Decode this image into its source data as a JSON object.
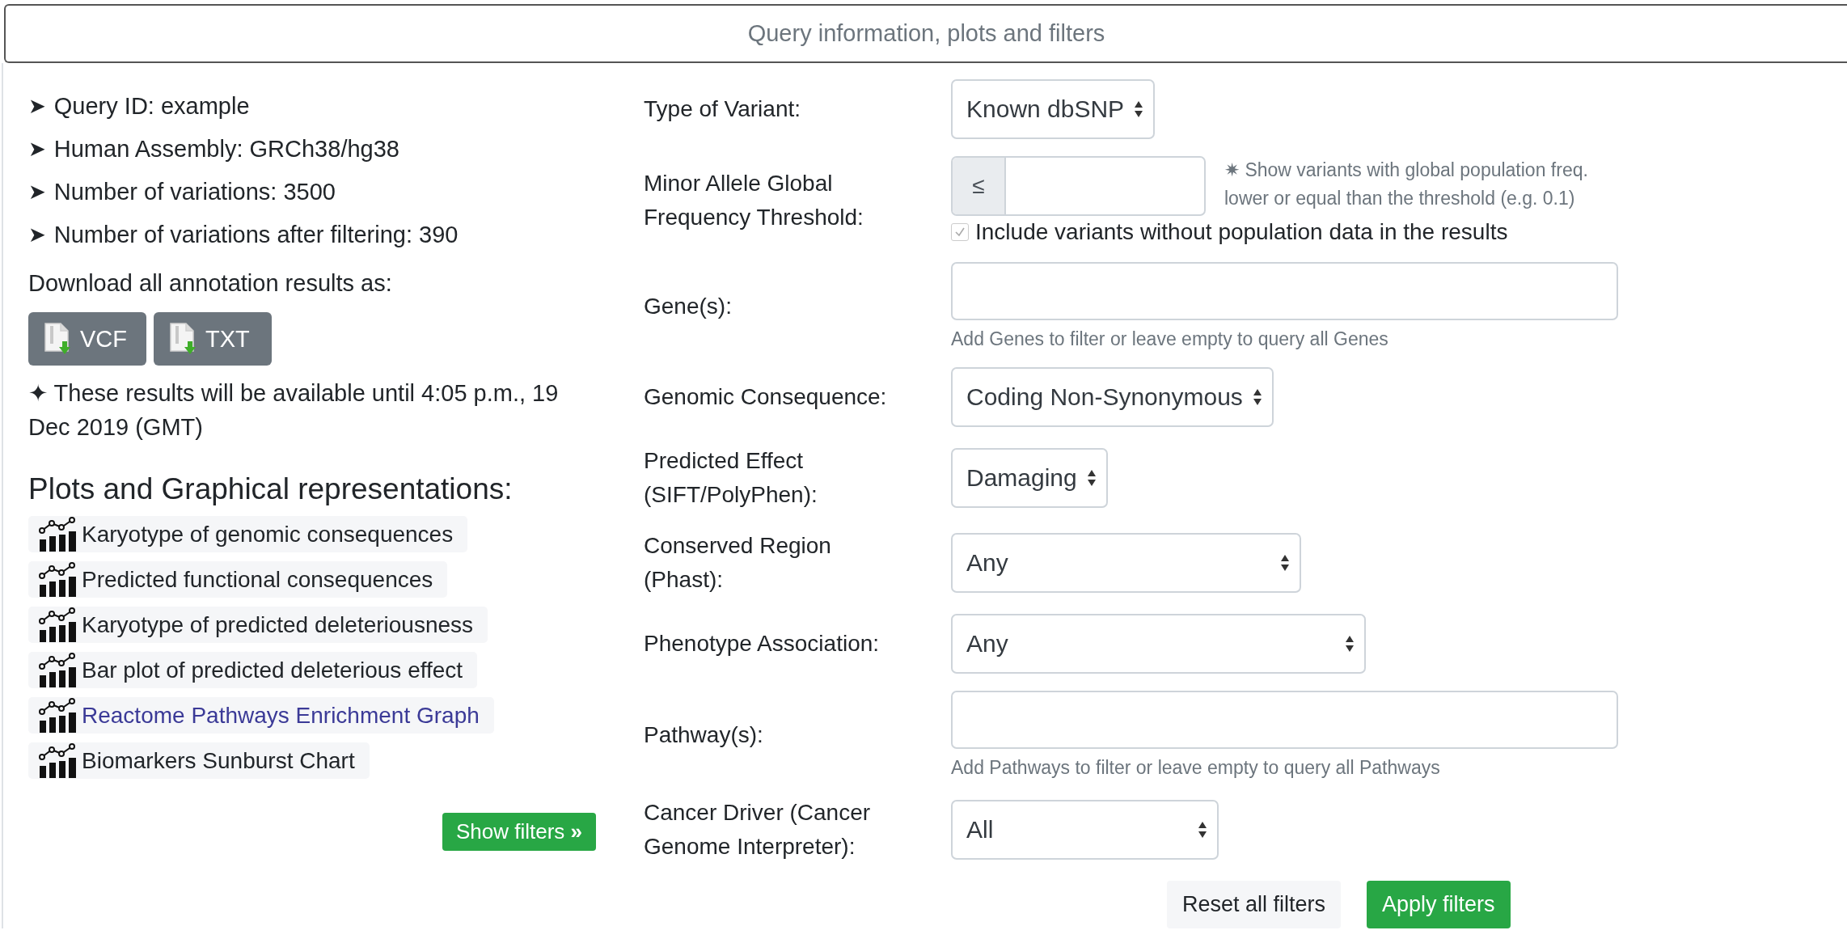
{
  "header": {
    "title": "Query information, plots and filters"
  },
  "query_info": [
    {
      "marker": "➤",
      "text": "Query ID: example"
    },
    {
      "marker": "➤",
      "text": "Human Assembly: GRCh38/hg38"
    },
    {
      "marker": "➤",
      "text": "Number of variations: 3500"
    },
    {
      "marker": "➤",
      "text": "Number of variations after filtering: 390"
    }
  ],
  "download": {
    "label": "Download all annotation results as:",
    "buttons": [
      {
        "label": "VCF"
      },
      {
        "label": "TXT"
      }
    ]
  },
  "availability": {
    "marker": "✦",
    "text": "These results will be available until 4:05 p.m., 19 Dec 2019 (GMT)"
  },
  "plots": {
    "title": "Plots and Graphical representations:",
    "items": [
      {
        "label": "Karyotype of genomic consequences",
        "visited": false
      },
      {
        "label": "Predicted functional consequences",
        "visited": false
      },
      {
        "label": "Karyotype of predicted deleteriousness",
        "visited": false
      },
      {
        "label": "Bar plot of predicted deleterious effect",
        "visited": false
      },
      {
        "label": "Reactome Pathways Enrichment Graph",
        "visited": true
      },
      {
        "label": "Biomarkers Sunburst Chart",
        "visited": false
      }
    ]
  },
  "show_filters": {
    "label": "Show filters",
    "marker": "»"
  },
  "filters": [
    {
      "kind": "select",
      "label": "Type of Variant:",
      "value": "Known dbSNP"
    },
    {
      "kind": "threshold",
      "label": "Minor Allele Global Frequency Threshold:",
      "prefix": "≤",
      "note_marker": "✷",
      "note": "Show variants with global population freq. lower or equal than the threshold (e.g. 0.1)",
      "checkbox": {
        "label": "Include variants without population data in the results",
        "checked": true,
        "disabled": true
      }
    },
    {
      "kind": "text",
      "label": "Gene(s):",
      "help": "Add Genes to filter or leave empty to query all Genes"
    },
    {
      "kind": "select",
      "label": "Genomic Consequence:",
      "value": "Coding Non-Synonymous"
    },
    {
      "kind": "select",
      "label": "Predicted Effect (SIFT/PolyPhen):",
      "value": "Damaging"
    },
    {
      "kind": "select",
      "label": "Conserved Region (Phast):",
      "value": "Any"
    },
    {
      "kind": "select",
      "label": "Phenotype Association:",
      "value": "Any"
    },
    {
      "kind": "text",
      "label": "Pathway(s):",
      "help": "Add Pathways to filter or leave empty to query all Pathways"
    },
    {
      "kind": "select",
      "label": "Cancer Driver (Cancer Genome Interpreter):",
      "value": "All"
    }
  ],
  "actions": [
    {
      "label": "Reset all filters",
      "kind": "secondary"
    },
    {
      "label": "Apply filters",
      "kind": "primary"
    }
  ]
}
